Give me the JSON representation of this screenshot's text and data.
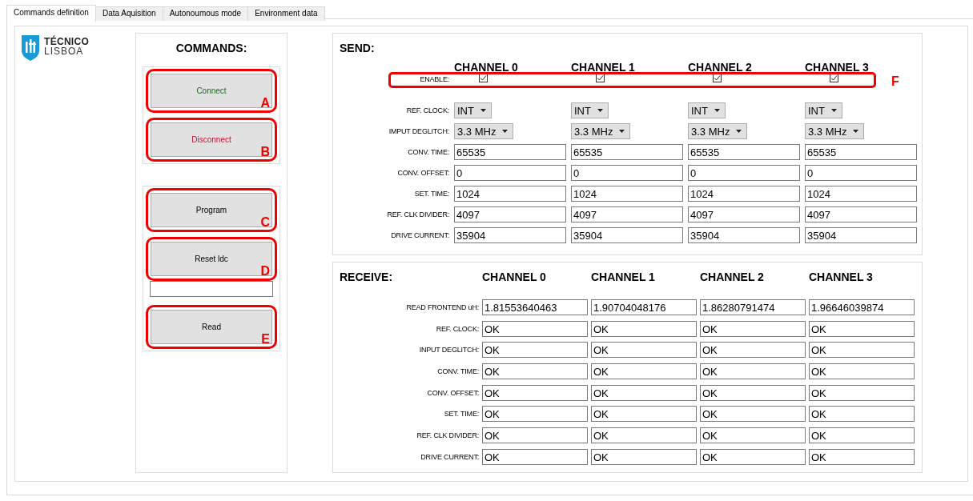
{
  "tabs": [
    {
      "label": "Commands definition",
      "selected": true
    },
    {
      "label": "Data Aquisition",
      "selected": false
    },
    {
      "label": "Autonoumous mode",
      "selected": false
    },
    {
      "label": "Environment data",
      "selected": false
    }
  ],
  "logo": {
    "line_1": "TÉCNICO",
    "line_2": "LISBOA"
  },
  "commands": {
    "title": "COMMANDS:",
    "groups": [
      [
        {
          "kind": "button",
          "label": "Connect",
          "color": "#1e6b1e",
          "callout": "A"
        },
        {
          "kind": "button",
          "label": "Disconnect",
          "color": "#c8102e",
          "callout": "B"
        }
      ],
      [
        {
          "kind": "button",
          "label": "Program",
          "color": "#000000",
          "callout": "C"
        },
        {
          "kind": "button",
          "label": "Reset ldc",
          "color": "#000000",
          "callout": "D"
        },
        {
          "kind": "field"
        },
        {
          "kind": "button",
          "label": "Read",
          "color": "#000000",
          "callout": "E"
        }
      ]
    ]
  },
  "send": {
    "title": "SEND:",
    "channels": [
      "CHANNEL 0",
      "CHANNEL 1",
      "CHANNEL 2",
      "CHANNEL 3"
    ],
    "enable": {
      "label": "ENABLE:",
      "checked": [
        true,
        true,
        true,
        true
      ],
      "callout": "F"
    },
    "rows": [
      {
        "kind": "dropdown",
        "label": "REF. CLOCK:",
        "values": [
          "INT",
          "INT",
          "INT",
          "INT"
        ]
      },
      {
        "kind": "dropdown",
        "label": "IMPUT DEGLITCH:",
        "values": [
          "3.3 MHz",
          "3.3 MHz",
          "3.3 MHz",
          "3.3 MHz"
        ]
      },
      {
        "kind": "field",
        "label": "CONV. TIME:",
        "values": [
          "65535",
          "65535",
          "65535",
          "65535"
        ]
      },
      {
        "kind": "field",
        "label": "CONV. OFFSET:",
        "values": [
          "0",
          "0",
          "0",
          "0"
        ]
      },
      {
        "kind": "field",
        "label": "SET. TIME:",
        "values": [
          "1024",
          "1024",
          "1024",
          "1024"
        ]
      },
      {
        "kind": "field",
        "label": "REF. CLK DIVIDER:",
        "values": [
          "4097",
          "4097",
          "4097",
          "4097"
        ]
      },
      {
        "kind": "field",
        "label": "DRIVE CURRENT:",
        "values": [
          "35904",
          "35904",
          "35904",
          "35904"
        ]
      }
    ]
  },
  "receive": {
    "title": "RECEIVE:",
    "channels": [
      "CHANNEL 0",
      "CHANNEL 1",
      "CHANNEL 2",
      "CHANNEL 3"
    ],
    "rows": [
      {
        "label": "READ FRONTEND uH:",
        "values": [
          "1.81553640463",
          "1.90704048176",
          "1.86280791474",
          "1.96646039874"
        ]
      },
      {
        "label": "REF. CLOCK:",
        "values": [
          "OK",
          "OK",
          "OK",
          "OK"
        ]
      },
      {
        "label": "INPUT DEGLITCH:",
        "values": [
          "OK",
          "OK",
          "OK",
          "OK"
        ]
      },
      {
        "label": "CONV. TIME:",
        "values": [
          "OK",
          "OK",
          "OK",
          "OK"
        ]
      },
      {
        "label": "CONV. OFFSET:",
        "values": [
          "OK",
          "OK",
          "OK",
          "OK"
        ]
      },
      {
        "label": "SET. TIME:",
        "values": [
          "OK",
          "OK",
          "OK",
          "OK"
        ]
      },
      {
        "label": "REF. CLK DIVIDER:",
        "values": [
          "OK",
          "OK",
          "OK",
          "OK"
        ]
      },
      {
        "label": "DRIVE CURRENT:",
        "values": [
          "OK",
          "OK",
          "OK",
          "OK"
        ]
      }
    ]
  }
}
